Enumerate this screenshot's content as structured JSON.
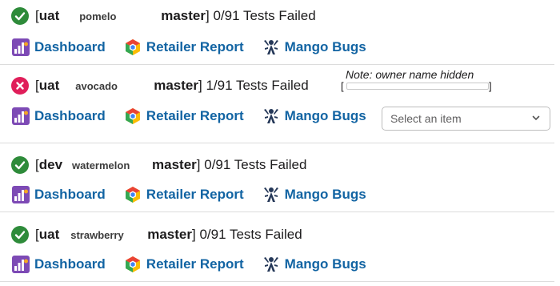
{
  "colors": {
    "pass": "#2e8b3a",
    "fail": "#e01e5a",
    "link": "#1264a3"
  },
  "note": {
    "text": "Note: owner name hidden",
    "open_bracket": "[",
    "close_bracket": "]"
  },
  "select": {
    "placeholder": "Select an item"
  },
  "runs": [
    {
      "status": "pass",
      "open_bracket": "[",
      "env": "uat",
      "service": "pomelo",
      "branch": "master",
      "close_bracket": "]",
      "result": " 0/91 Tests Failed",
      "links": {
        "dashboard": "Dashboard",
        "retailer_report": "Retailer Report",
        "mango_bugs": "Mango Bugs"
      }
    },
    {
      "status": "fail",
      "open_bracket": "[",
      "env": "uat",
      "service": "avocado",
      "branch": "master",
      "close_bracket": "]",
      "result": " 1/91 Tests Failed",
      "links": {
        "dashboard": "Dashboard",
        "retailer_report": "Retailer Report",
        "mango_bugs": "Mango Bugs"
      }
    },
    {
      "status": "pass",
      "open_bracket": "[",
      "env": "dev",
      "service": "watermelon",
      "branch": "master",
      "close_bracket": "]",
      "result": " 0/91 Tests Failed",
      "links": {
        "dashboard": "Dashboard",
        "retailer_report": "Retailer Report",
        "mango_bugs": "Mango Bugs"
      }
    },
    {
      "status": "pass",
      "open_bracket": "[",
      "env": "uat",
      "service": "strawberry",
      "branch": "master",
      "close_bracket": "]",
      "result": " 0/91 Tests Failed",
      "links": {
        "dashboard": "Dashboard",
        "retailer_report": "Retailer Report",
        "mango_bugs": "Mango Bugs"
      }
    }
  ]
}
